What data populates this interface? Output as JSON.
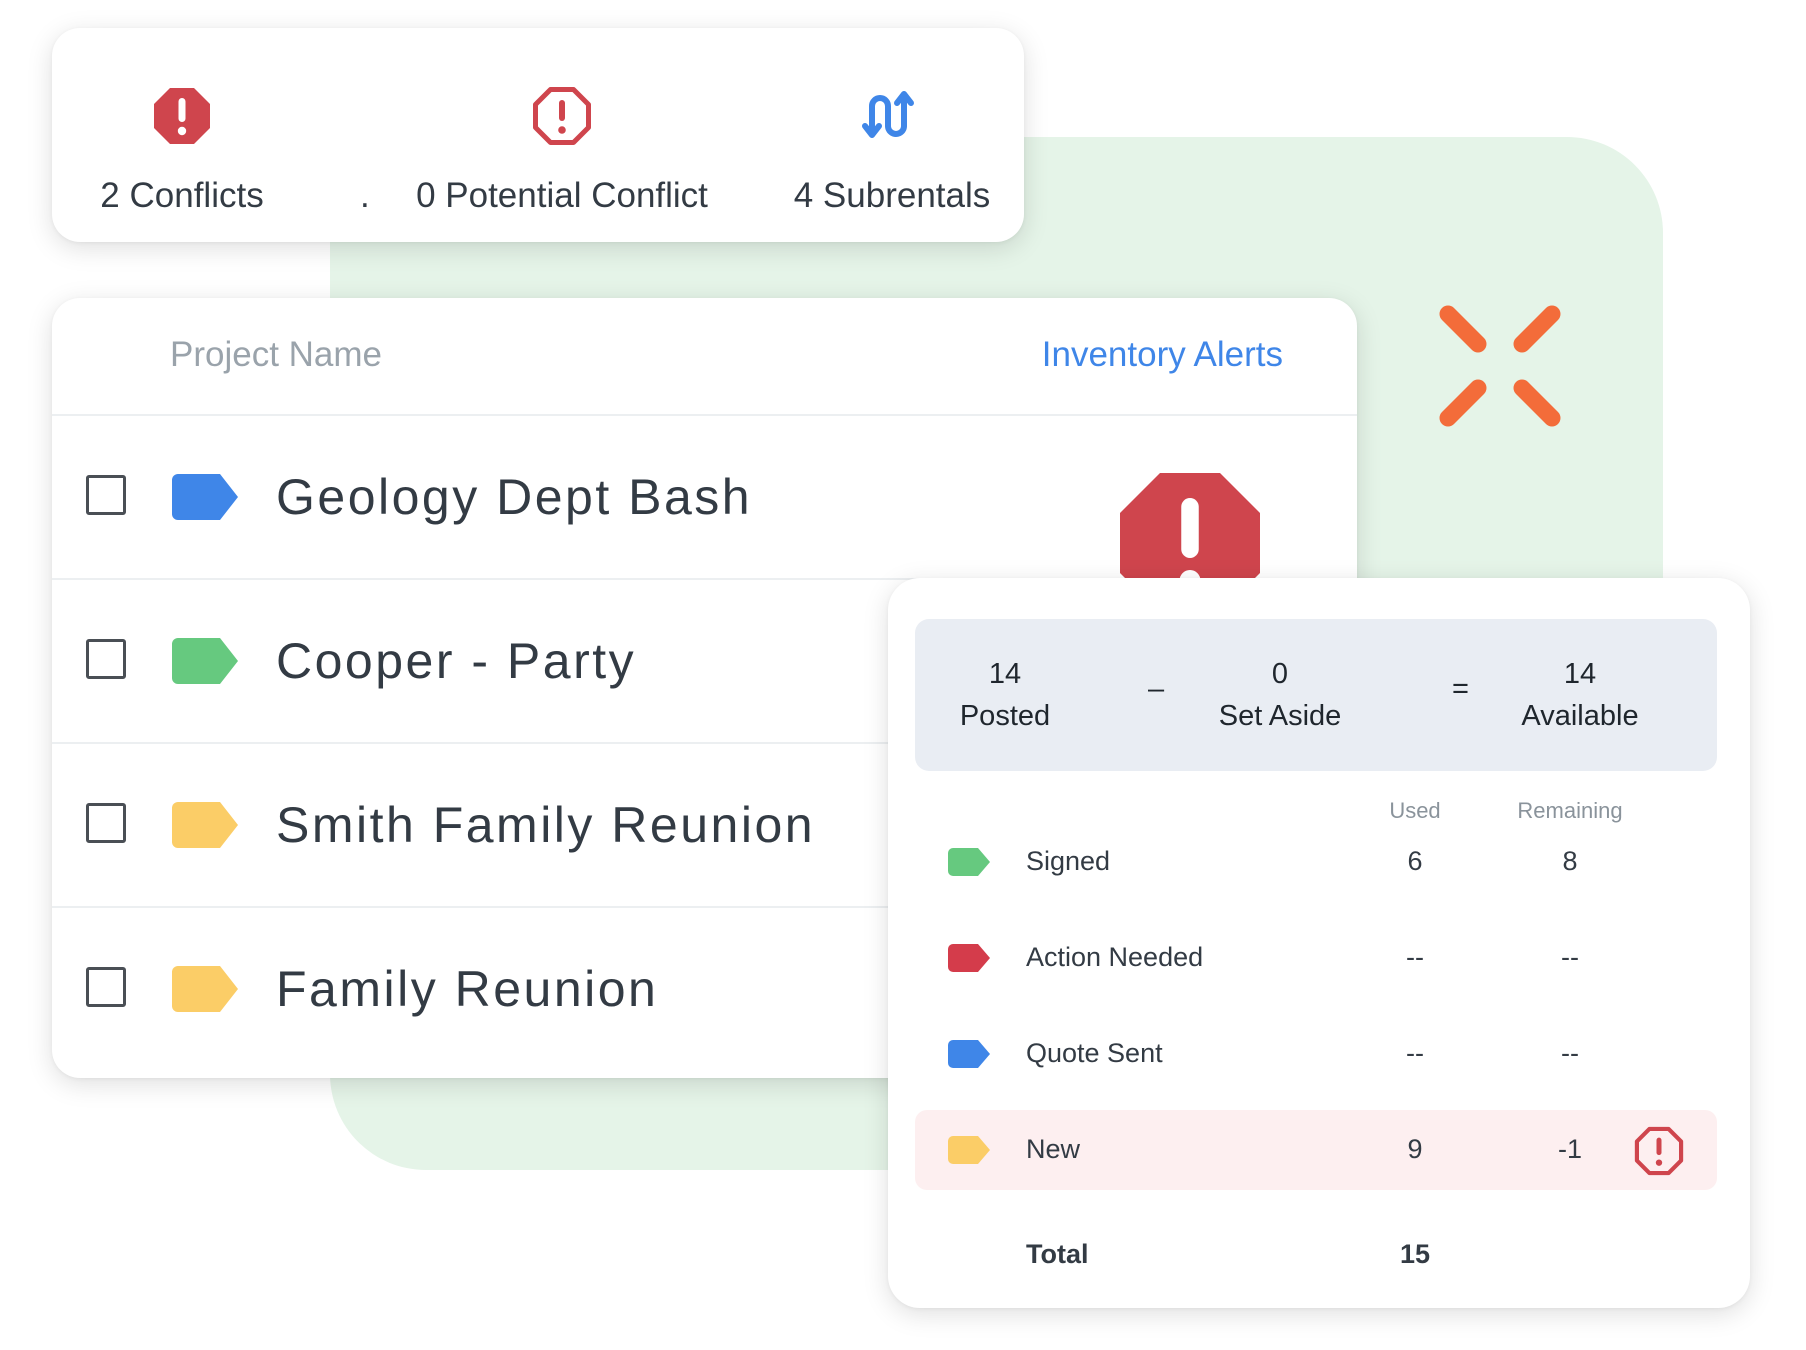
{
  "colors": {
    "conflict_red": "#cf454d",
    "potential_gray": "#e1e4e7",
    "subrental_blue": "#3f86e8",
    "status_blue": "#3f86e8",
    "status_green": "#66c97f",
    "status_yellow": "#fbcd67",
    "status_red": "#d43c4b",
    "logo_orange": "#f36c3a",
    "bg_green": "#e5f4e8"
  },
  "summary": {
    "conflicts": "2 Conflicts",
    "separator": ".",
    "potential": "0 Potential Conflict",
    "subrentals": "4 Subrentals"
  },
  "projects": {
    "header": {
      "name": "Project Name",
      "alerts": "Inventory Alerts"
    },
    "rows": [
      {
        "name": "Geology Dept Bash",
        "tag_color": "blue",
        "alert_icons": [
          "conflict-icon",
          "potential-conflict-icon",
          "subrental-icon"
        ]
      },
      {
        "name": "Cooper - Party",
        "tag_color": "green"
      },
      {
        "name": "Smith Family Reunion",
        "tag_color": "yellow"
      },
      {
        "name": "Family Reunion",
        "tag_color": "yellow"
      }
    ]
  },
  "detail": {
    "posted": {
      "value": "14",
      "label": "Posted"
    },
    "minus": "–",
    "set_aside": {
      "value": "0",
      "label": "Set Aside"
    },
    "equals": "=",
    "available": {
      "value": "14",
      "label": "Available"
    },
    "columns": {
      "used": "Used",
      "remaining": "Remaining"
    },
    "rows": [
      {
        "status": "Signed",
        "tag_color": "green",
        "used": "6",
        "remaining": "8"
      },
      {
        "status": "Action Needed",
        "tag_color": "red",
        "used": "--",
        "remaining": "--"
      },
      {
        "status": "Quote Sent",
        "tag_color": "blue",
        "used": "--",
        "remaining": "--"
      },
      {
        "status": "New",
        "tag_color": "yellow",
        "used": "9",
        "remaining": "-1",
        "highlighted": true,
        "warning_icon": "conflict-outline-icon"
      }
    ],
    "total": {
      "label": "Total",
      "used": "15"
    }
  }
}
